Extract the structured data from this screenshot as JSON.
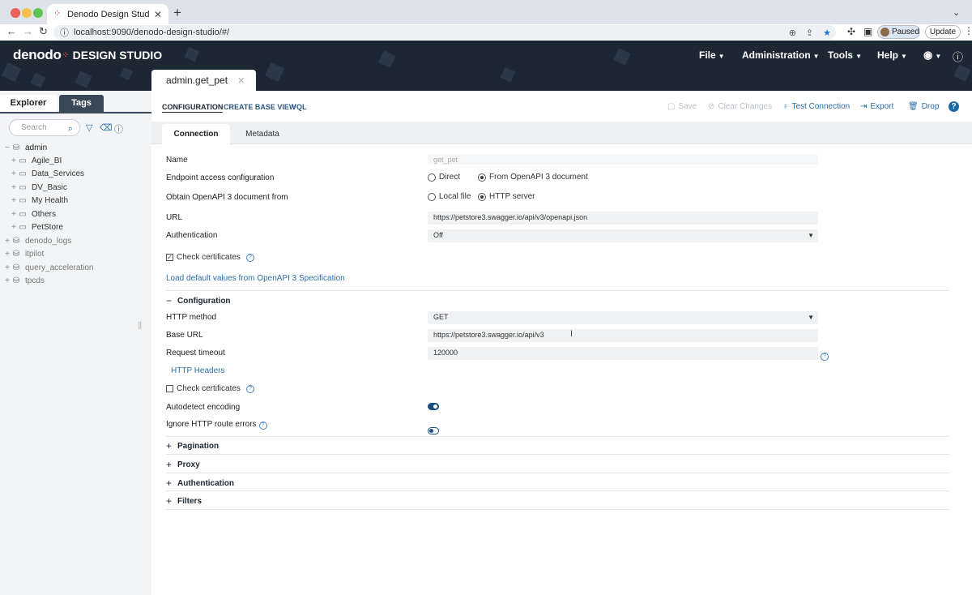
{
  "browser": {
    "tab_title": "Denodo Design Studio",
    "url": "localhost:9090/denodo-design-studio/#/",
    "profile_status": "Paused",
    "update_label": "Update"
  },
  "app": {
    "logo_text": "denodo",
    "logo_suffix": "DESIGN STUDIO",
    "menu": [
      "File",
      "Administration",
      "Tools",
      "Help"
    ],
    "open_tab": "admin.get_pet"
  },
  "left": {
    "tabs": [
      "Explorer",
      "Tags"
    ],
    "search_placeholder": "Search",
    "tree": [
      {
        "label": "admin",
        "level": 0,
        "kind": "db"
      },
      {
        "label": "Agile_BI",
        "level": 1,
        "kind": "folder"
      },
      {
        "label": "Data_Services",
        "level": 1,
        "kind": "folder"
      },
      {
        "label": "DV_Basic",
        "level": 1,
        "kind": "folder"
      },
      {
        "label": "My Health",
        "level": 1,
        "kind": "folder"
      },
      {
        "label": "Others",
        "level": 1,
        "kind": "folder"
      },
      {
        "label": "PetStore",
        "level": 1,
        "kind": "folder"
      },
      {
        "label": "denodo_logs",
        "level": 0,
        "kind": "db"
      },
      {
        "label": "itpilot",
        "level": 0,
        "kind": "db"
      },
      {
        "label": "query_acceleration",
        "level": 0,
        "kind": "db"
      },
      {
        "label": "tpcds",
        "level": 0,
        "kind": "db"
      }
    ]
  },
  "main": {
    "sublinks": [
      "CONFIGURATION",
      "CREATE BASE VIEW",
      "VQL"
    ],
    "actions": {
      "save": "Save",
      "clear": "Clear Changes",
      "test": "Test Connection",
      "export": "Export",
      "drop": "Drop"
    },
    "inner_tabs": [
      "Connection",
      "Metadata"
    ],
    "form": {
      "name_label": "Name",
      "name_value": "get_pet",
      "endpoint_label": "Endpoint access configuration",
      "endpoint_options": [
        "Direct",
        "From OpenAPI 3 document"
      ],
      "endpoint_selected": "From OpenAPI 3 document",
      "obtain_label": "Obtain OpenAPI 3 document from",
      "obtain_options": [
        "Local file",
        "HTTP server"
      ],
      "obtain_selected": "HTTP server",
      "url_label": "URL",
      "url_value": "https://petstore3.swagger.io/api/v3/openapi.json",
      "auth_label": "Authentication",
      "auth_value": "Off",
      "check_cert_label": "Check certificates",
      "check_cert_checked": true,
      "load_defaults": "Load default values from OpenAPI 3 Specification"
    },
    "configuration": {
      "title": "Configuration",
      "http_method_label": "HTTP method",
      "http_method_value": "GET",
      "base_url_label": "Base URL",
      "base_url_value": "https://petstore3.swagger.io/api/v3",
      "timeout_label": "Request timeout",
      "timeout_value": "120000",
      "http_headers": "HTTP Headers",
      "check_cert_label": "Check certificates",
      "check_cert_checked": false,
      "autodetect_label": "Autodetect encoding",
      "autodetect_on": true,
      "ignore_errors_label": "Ignore HTTP route errors",
      "ignore_errors_on": false
    },
    "sections": [
      "Pagination",
      "Proxy",
      "Authentication",
      "Filters"
    ]
  }
}
